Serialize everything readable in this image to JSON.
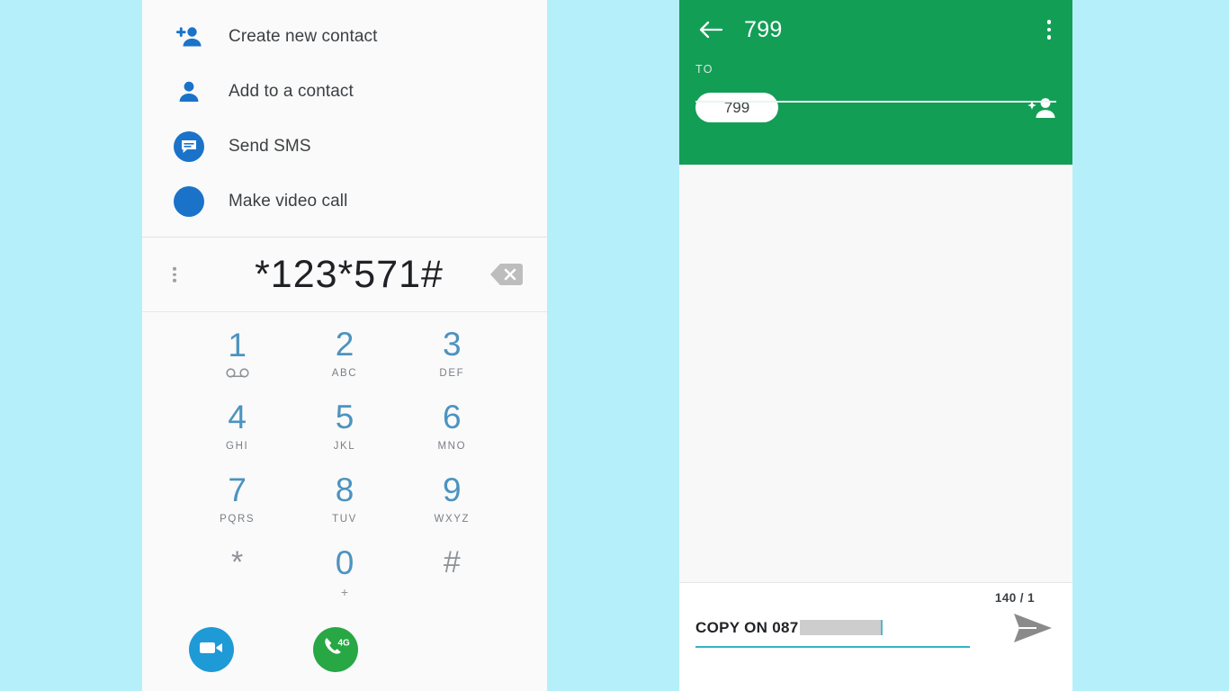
{
  "background_color": "#b5f0fa",
  "dialer": {
    "context_menu": {
      "items": [
        {
          "label": "Create new contact",
          "icon": "person-add-icon"
        },
        {
          "label": "Add to a contact",
          "icon": "person-icon"
        },
        {
          "label": "Send SMS",
          "icon": "sms-bubble-icon"
        },
        {
          "label": "Make video call",
          "icon": "video-call-circle-icon"
        }
      ]
    },
    "display": {
      "number": "*123*571#",
      "overflow_icon": "more-vertical-icon",
      "backspace_icon": "backspace-icon"
    },
    "keypad": [
      {
        "digit": "1",
        "sub": "",
        "sub_icon": "voicemail-icon",
        "grey": false
      },
      {
        "digit": "2",
        "sub": "ABC",
        "sub_icon": "",
        "grey": false
      },
      {
        "digit": "3",
        "sub": "DEF",
        "sub_icon": "",
        "grey": false
      },
      {
        "digit": "4",
        "sub": "GHI",
        "sub_icon": "",
        "grey": false
      },
      {
        "digit": "5",
        "sub": "JKL",
        "sub_icon": "",
        "grey": false
      },
      {
        "digit": "6",
        "sub": "MNO",
        "sub_icon": "",
        "grey": false
      },
      {
        "digit": "7",
        "sub": "PQRS",
        "sub_icon": "",
        "grey": false
      },
      {
        "digit": "8",
        "sub": "TUV",
        "sub_icon": "",
        "grey": false
      },
      {
        "digit": "9",
        "sub": "WXYZ",
        "sub_icon": "",
        "grey": false
      },
      {
        "digit": "*",
        "sub": "",
        "sub_icon": "",
        "grey": true
      },
      {
        "digit": "0",
        "sub": "+",
        "sub_icon": "",
        "grey": false
      },
      {
        "digit": "#",
        "sub": "",
        "sub_icon": "",
        "grey": true
      }
    ],
    "actions": {
      "video_call_icon": "video-camera-icon",
      "video_call_color": "#1e9ad6",
      "voice_call_icon": "phone-4g-icon",
      "voice_call_color": "#28a745",
      "voice_call_badge": "4G"
    },
    "colors": {
      "digit_blue": "#4c93bf",
      "digit_grey": "#8e9296",
      "accent_blue": "#1a73c9"
    }
  },
  "sms": {
    "header": {
      "back_icon": "back-arrow-icon",
      "title": "799",
      "overflow_icon": "more-vertical-icon",
      "to_label": "TO",
      "recipient_chip": "799",
      "add_contact_icon": "person-add-sparkle-icon",
      "color": "#139e56"
    },
    "footer": {
      "char_counter": "140 / 1",
      "message_text": "COPY ON 087",
      "message_redacted": true,
      "send_icon": "send-arrow-icon",
      "underline_color": "#33b5c4"
    }
  }
}
